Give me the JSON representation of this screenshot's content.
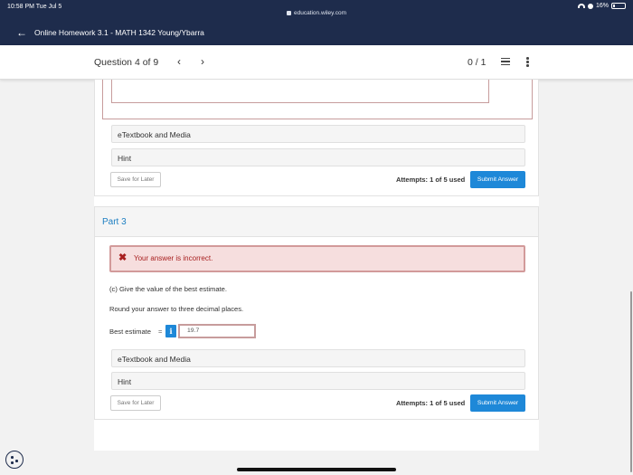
{
  "status_bar": {
    "time": "10:58 PM  Tue Jul 5",
    "url": "education.wiley.com",
    "battery": "16%"
  },
  "header": {
    "title": "Online Homework 3.1 - MATH 1342 Young/Ybarra"
  },
  "question_nav": {
    "label": "Question 4 of 9",
    "prev": "‹",
    "next": "›",
    "score": "0 / 1"
  },
  "previous_part": {
    "etextbook_label": "eTextbook and Media",
    "hint_label": "Hint",
    "save_later_label": "Save for Later",
    "attempts": "Attempts: 1 of 5 used",
    "submit_label": "Submit Answer"
  },
  "part3": {
    "title": "Part 3",
    "error_message": "Your answer is incorrect.",
    "question": "(c) Give the value of the best estimate.",
    "instruction": "Round your answer to three decimal places.",
    "best_estimate_label": "Best estimate",
    "equals": "=",
    "info_label": "i",
    "answer_value": "19.7",
    "etextbook_label": "eTextbook and Media",
    "hint_label": "Hint",
    "save_later_label": "Save for Later",
    "attempts": "Attempts: 1 of 5 used",
    "submit_label": "Submit Answer"
  },
  "colors": {
    "header_bg": "#1e2c4c",
    "accent_blue": "#1e88d8",
    "part_title": "#1e7fc2",
    "error_bg": "#f6dede",
    "error_text": "#a82020"
  }
}
